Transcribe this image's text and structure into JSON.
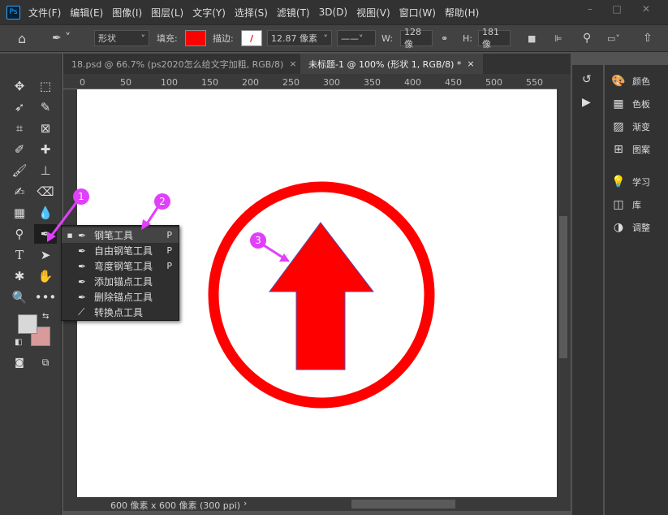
{
  "menubar": {
    "logo": "Ps",
    "items": [
      "文件(F)",
      "编辑(E)",
      "图像(I)",
      "图层(L)",
      "文字(Y)",
      "选择(S)",
      "滤镜(T)",
      "3D(D)",
      "视图(V)",
      "窗口(W)",
      "帮助(H)"
    ],
    "minimize": "–",
    "maximize": "□",
    "close": "✕"
  },
  "options": {
    "mode": "形状",
    "fill_label": "填充:",
    "fill_color": "#ff0000",
    "stroke_label": "描边:",
    "stroke_width": "12.87 像素",
    "w_label": "W:",
    "w_value": "128 像",
    "h_label": "H:",
    "h_value": "181 像"
  },
  "tabs": [
    {
      "label": "18.psd @ 66.7% (ps2020怎么给文字加粗, RGB/8)",
      "close": "×"
    },
    {
      "label": "未标题-1 @ 100% (形状 1, RGB/8) *",
      "close": "×"
    }
  ],
  "ruler": {
    "h_labels": [
      "0",
      "50",
      "100",
      "150",
      "200",
      "250",
      "300",
      "350",
      "400",
      "450",
      "500",
      "550"
    ]
  },
  "status": {
    "text": "600 像素 x 600 像素 (300 ppi)",
    "arrow": "›"
  },
  "panels": [
    {
      "label": "颜色",
      "icon": "palette-icon"
    },
    {
      "label": "色板",
      "icon": "grid-icon"
    },
    {
      "label": "渐变",
      "icon": "gradient-icon"
    },
    {
      "label": "图案",
      "icon": "pattern-icon"
    },
    {
      "label": "学习",
      "icon": "bulb-icon"
    },
    {
      "label": "库",
      "icon": "library-icon"
    },
    {
      "label": "调整",
      "icon": "adjust-icon"
    }
  ],
  "flyout": [
    {
      "label": "钢笔工具",
      "shortcut": "P",
      "selected": true
    },
    {
      "label": "自由钢笔工具",
      "shortcut": "P"
    },
    {
      "label": "弯度钢笔工具",
      "shortcut": "P"
    },
    {
      "label": "添加锚点工具",
      "shortcut": ""
    },
    {
      "label": "删除锚点工具",
      "shortcut": ""
    },
    {
      "label": "转换点工具",
      "shortcut": ""
    }
  ],
  "annotations": [
    "1",
    "2",
    "3"
  ],
  "colors": {
    "foreground": "#d8d8d8",
    "background": "#d99a9a",
    "shape": "#ff0000",
    "annotation": "#e040fb"
  }
}
